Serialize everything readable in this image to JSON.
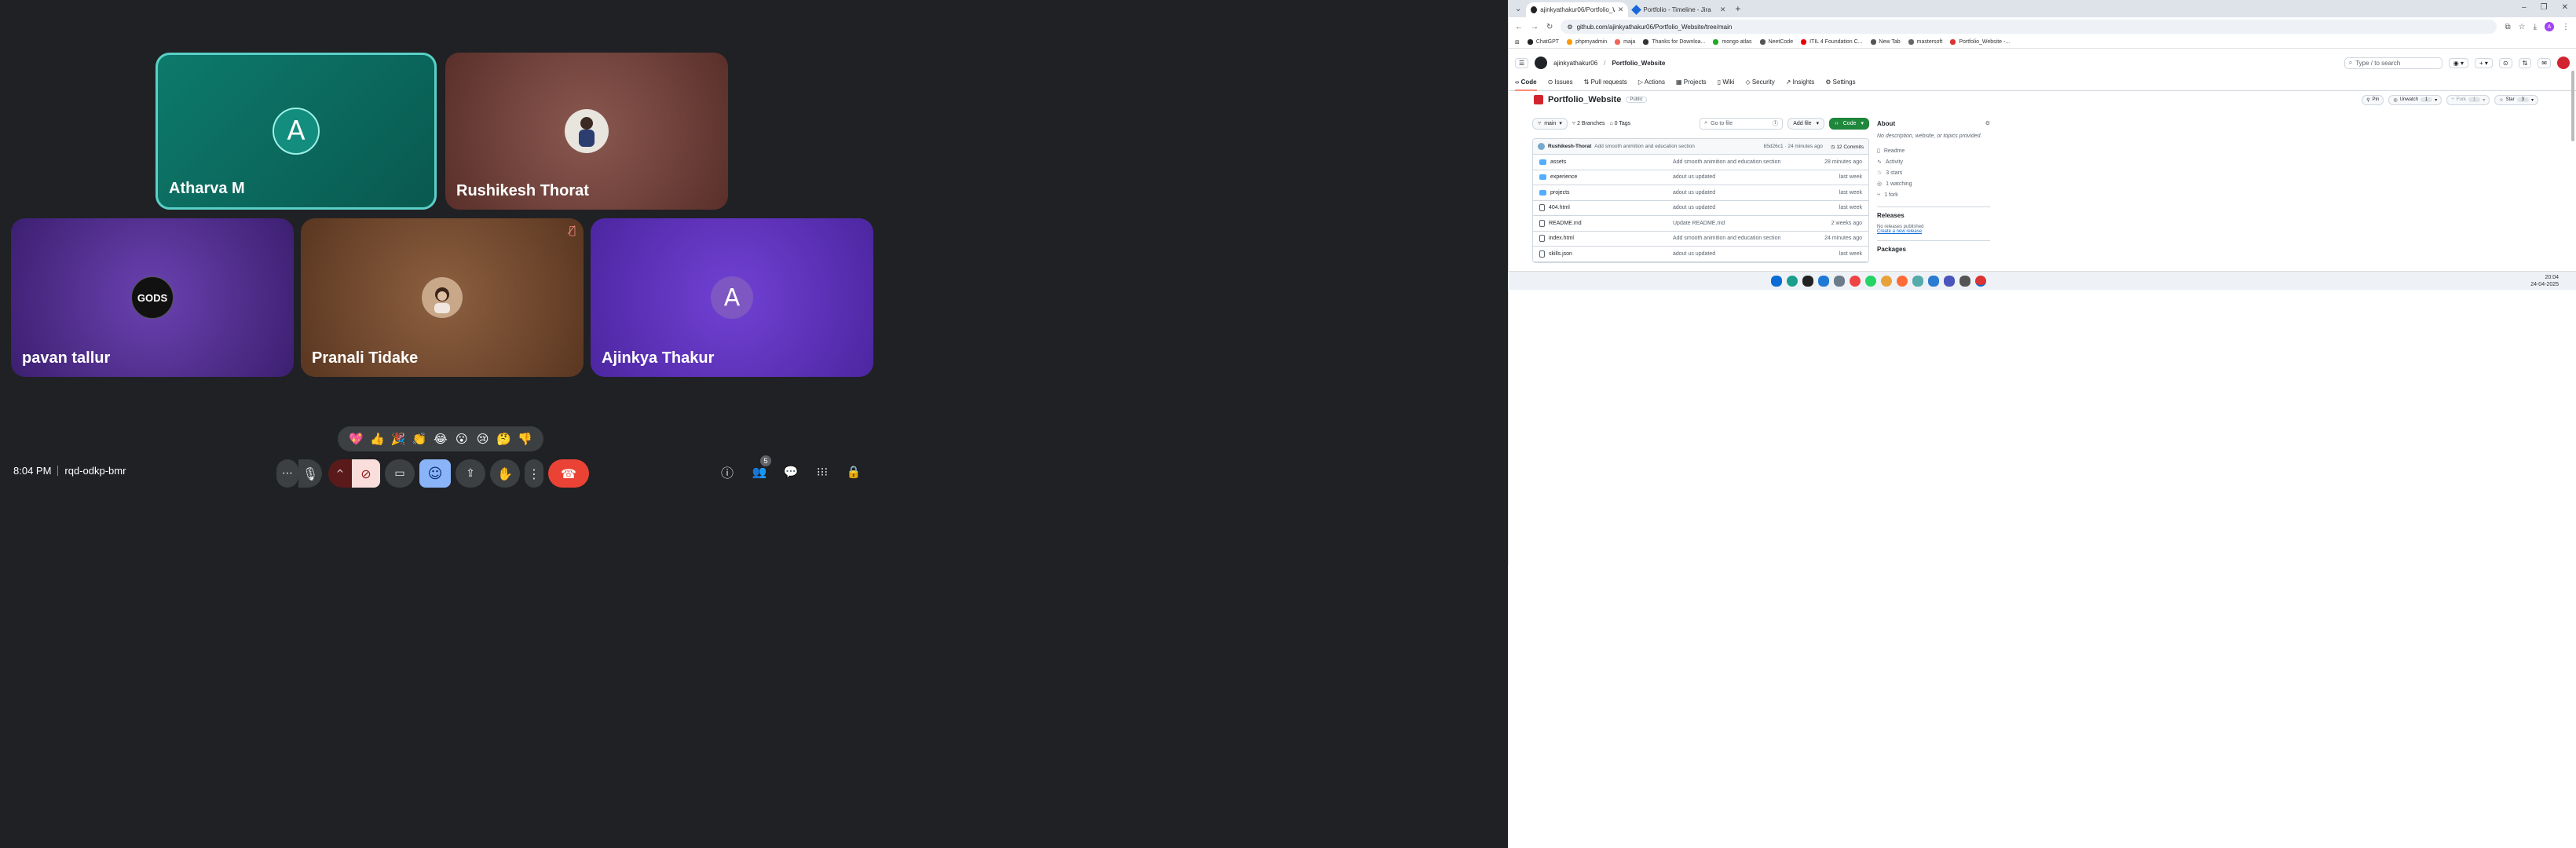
{
  "meet": {
    "participants": [
      {
        "name": "Atharva M",
        "initial": "A",
        "bg": "#0b6f63",
        "avatar_bg": "#138d7e"
      },
      {
        "name": "Rushikesh Thorat",
        "initial": "",
        "bg": "#6f3b35",
        "avatar_bg": "#2c3e70"
      },
      {
        "name": "pavan tallur",
        "initial": "",
        "bg": "#4a2b82",
        "avatar_bg": "#111111"
      },
      {
        "name": "Pranali Tidake",
        "initial": "",
        "bg": "#7a4e33",
        "avatar_bg": "#a27a5c"
      },
      {
        "name": "Ajinkya Thakur",
        "initial": "A",
        "bg": "#5b2fb4",
        "avatar_bg": "#7e57c2"
      }
    ],
    "pavan_logo_text": "GODS",
    "reactions": [
      "💖",
      "👍",
      "🎉",
      "👏",
      "😂",
      "😮",
      "😢",
      "🤔",
      "👎"
    ],
    "time": "8:04 PM",
    "meeting_code": "rqd-odkp-bmr",
    "participant_count": "5",
    "accent_speaking": "#5ad1c8",
    "end_call_color": "#ea4335"
  },
  "browser": {
    "tabs": [
      {
        "title": "ajinkyathakur06/Portfolio_Web",
        "active": true
      },
      {
        "title": "Portfolio - Timeline - Jira",
        "active": false
      }
    ],
    "url": "github.com/ajinkyathakur06/Portfolio_Website/tree/main",
    "bookmarks": [
      "ChatGPT",
      "phpmyadmin",
      "maja",
      "Thanks for Downloa...",
      "mongo atlas",
      "NeetCode",
      "ITIL 4 Foundation C...",
      "New Tab",
      "mastersoft",
      "Portfolio_Website -..."
    ]
  },
  "github": {
    "owner": "ajinkyathakur06",
    "repo": "Portfolio_Website",
    "search_placeholder": "Type / to search",
    "nav": [
      "Code",
      "Issues",
      "Pull requests",
      "Actions",
      "Projects",
      "Wiki",
      "Security",
      "Insights",
      "Settings"
    ],
    "visibility": "Public",
    "pin": "Pin",
    "unwatch": "Unwatch",
    "unwatch_count": "1",
    "fork": "Fork",
    "fork_count": "1",
    "star": "Star",
    "star_count": "3",
    "branch": "main",
    "branches": "2 Branches",
    "tags": "0 Tags",
    "goto_placeholder": "Go to file",
    "goto_key": "t",
    "add_file": "Add file",
    "code_btn": "Code",
    "commit": {
      "author": "Rushikesh-Thorat",
      "message": "Add smooth animition and education section",
      "hash": "b5d26c1 · 24 minutes ago",
      "commits": "12 Commits"
    },
    "files": [
      {
        "name": "assets",
        "type": "folder",
        "msg": "Add smooth animition and education section",
        "date": "28 minutes ago"
      },
      {
        "name": "experience",
        "type": "folder",
        "msg": "adout us updated",
        "date": "last week"
      },
      {
        "name": "projects",
        "type": "folder",
        "msg": "adout us updated",
        "date": "last week"
      },
      {
        "name": "404.html",
        "type": "file",
        "msg": "adout us updated",
        "date": "last week"
      },
      {
        "name": "README.md",
        "type": "file",
        "msg": "Update README.md",
        "date": "2 weeks ago"
      },
      {
        "name": "index.html",
        "type": "file",
        "msg": "Add smooth animition and education section",
        "date": "24 minutes ago"
      },
      {
        "name": "skills.json",
        "type": "file",
        "msg": "adout us updated",
        "date": "last week"
      }
    ],
    "about": {
      "title": "About",
      "desc": "No description, website, or topics provided.",
      "items": [
        "Readme",
        "Activity",
        "3 stars",
        "1 watching",
        "1 fork"
      ],
      "releases_title": "Releases",
      "no_releases": "No releases published",
      "create_release": "Create a new release",
      "packages_title": "Packages"
    }
  },
  "taskbar": {
    "time": "20:04",
    "date": "24-04-2025"
  }
}
